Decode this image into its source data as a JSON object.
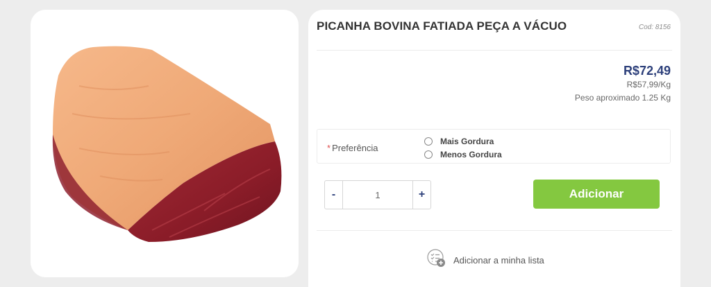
{
  "product": {
    "title": "PICANHA BOVINA FATIADA PEÇA A VÁCUO",
    "code": "Cod: 8156",
    "price": "R$72,49",
    "price_per_kg": "R$57,99/Kg",
    "weight": "Peso aproximado 1.25 Kg",
    "image_icon": "picanha-meat-photo"
  },
  "preference": {
    "required_mark": "*",
    "label": "Preferência",
    "options": [
      "Mais Gordura",
      "Menos Gordura"
    ]
  },
  "quantity": {
    "minus": "-",
    "value": "1",
    "plus": "+"
  },
  "actions": {
    "add": "Adicionar",
    "add_to_list": "Adicionar a minha lista",
    "list_icon": "shopping-list-add-icon"
  },
  "colors": {
    "background": "#ededed",
    "price": "#2c3f7a",
    "add_button": "#84c840",
    "required": "#e05050"
  }
}
